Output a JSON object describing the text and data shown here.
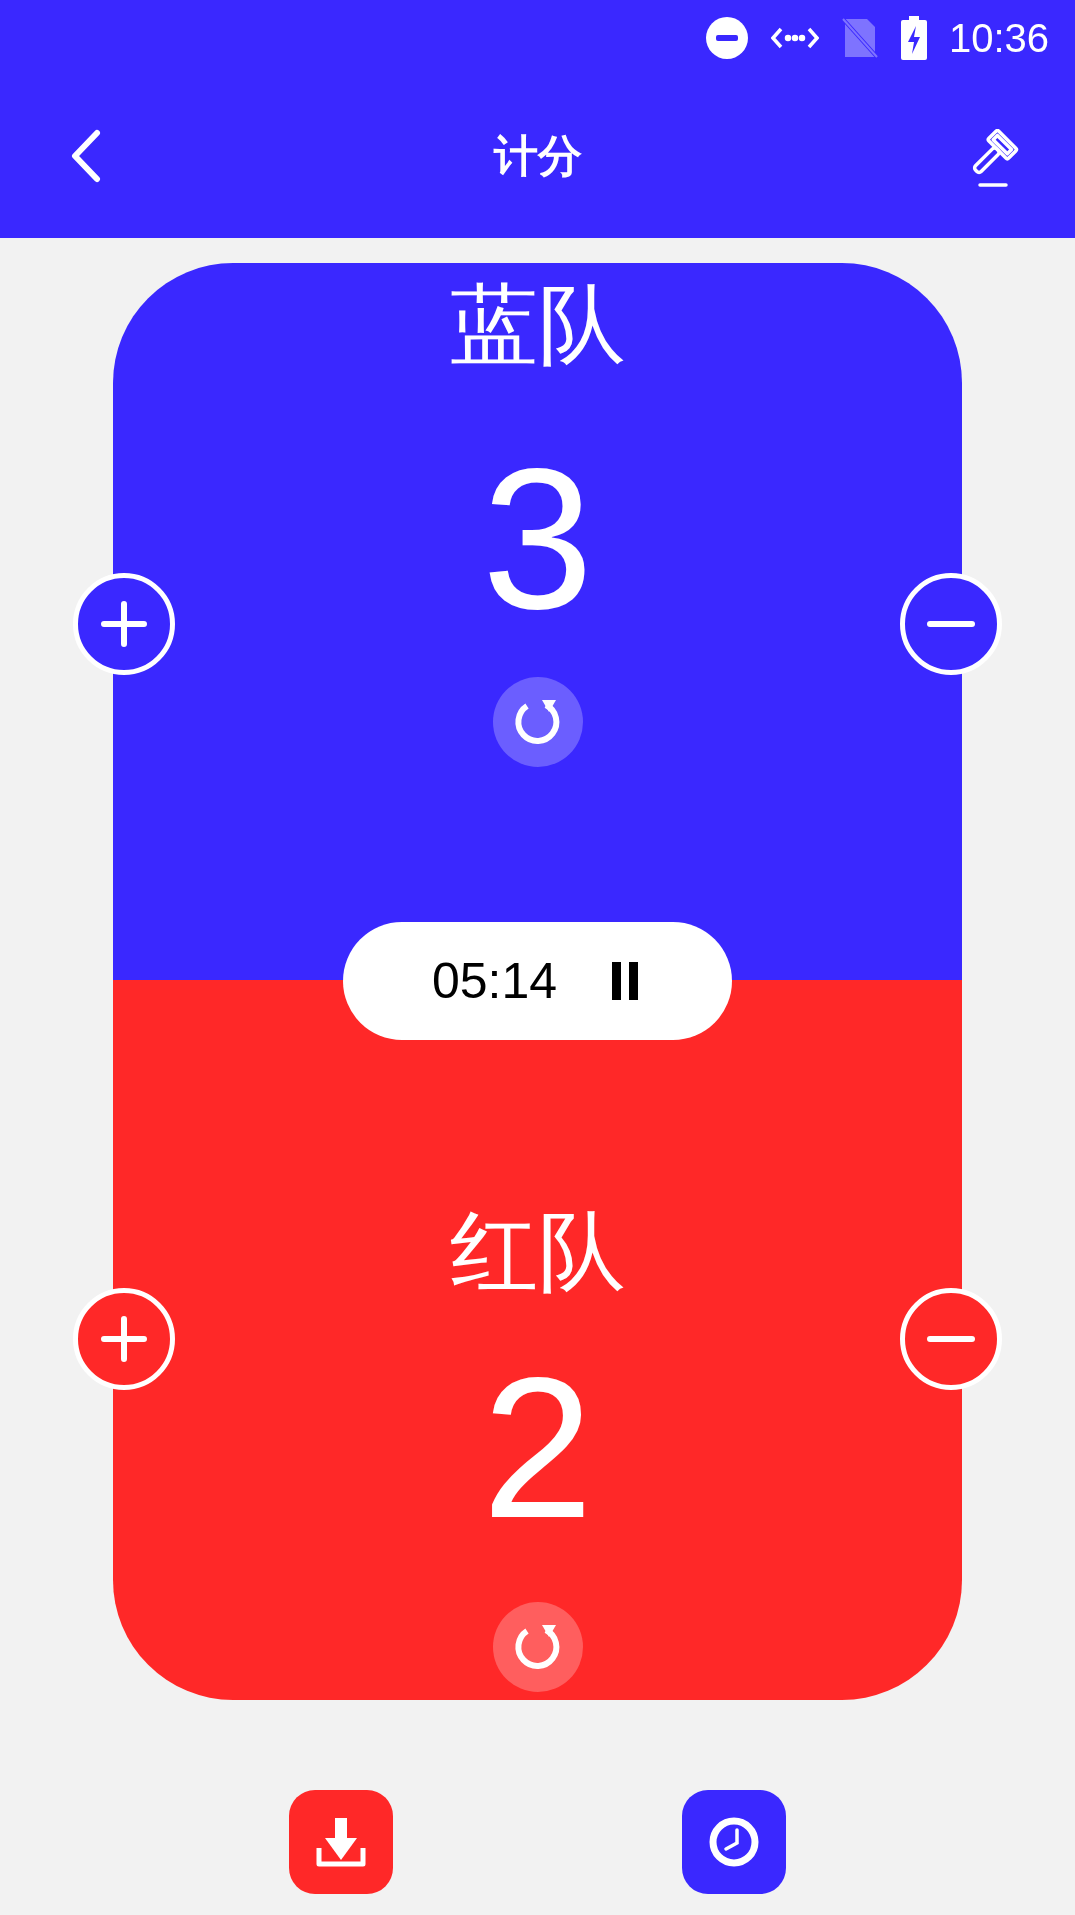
{
  "status_bar": {
    "time": "10:36"
  },
  "header": {
    "title": "计分"
  },
  "teams": [
    {
      "name": "蓝队",
      "score": "3",
      "color": "#3a28ff"
    },
    {
      "name": "红队",
      "score": "2",
      "color": "#ff2828"
    }
  ],
  "timer": {
    "time": "05:14",
    "running": true
  },
  "bottom_actions": [
    {
      "kind": "download",
      "color": "#ff2828"
    },
    {
      "kind": "clock",
      "color": "#3a28ff"
    }
  ]
}
